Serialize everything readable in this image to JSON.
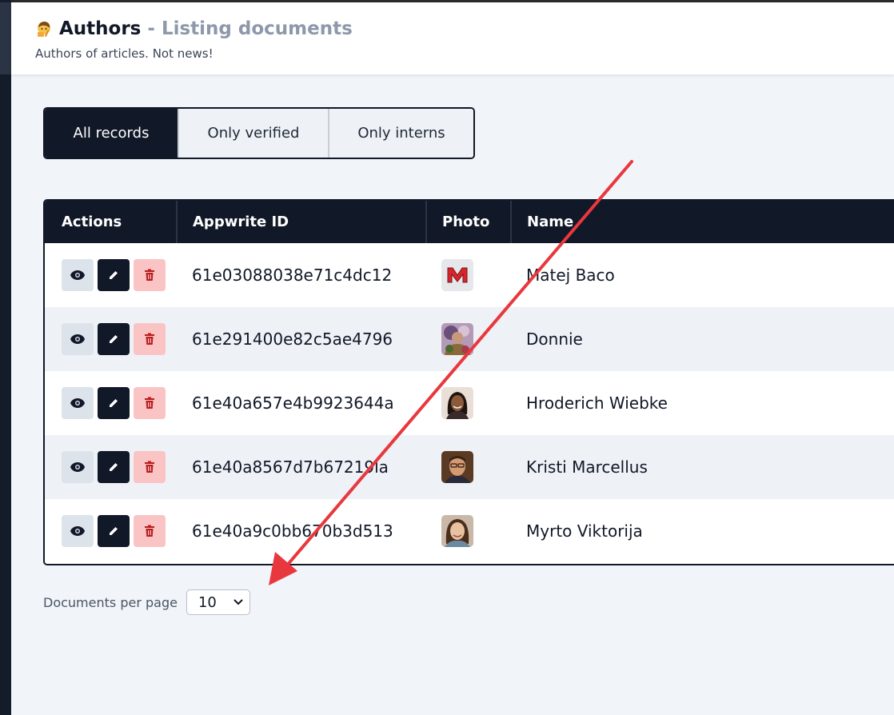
{
  "header": {
    "title": "Authors",
    "separator_title": "- Listing documents",
    "subtitle": "Authors of articles. Not news!",
    "icon": "author-emoji-icon"
  },
  "filters": [
    {
      "label": "All records",
      "active": true
    },
    {
      "label": "Only verified",
      "active": false
    },
    {
      "label": "Only interns",
      "active": false
    }
  ],
  "table": {
    "columns": [
      "Actions",
      "Appwrite ID",
      "Photo",
      "Name"
    ],
    "rows": [
      {
        "id": "61e03088038e71c4dc12",
        "name": "Matej Baco",
        "photo": "brand-logo-m"
      },
      {
        "id": "61e291400e82c5ae4796",
        "name": "Donnie",
        "photo": "avatar-photo"
      },
      {
        "id": "61e40a657e4b9923644a",
        "name": "Hroderich Wiebke",
        "photo": "avatar-photo"
      },
      {
        "id": "61e40a8567d7b67219la",
        "name": "Kristi Marcellus",
        "photo": "avatar-photo"
      },
      {
        "id": "61e40a9c0bb670b3d513",
        "name": "Myrto Viktorija",
        "photo": "avatar-photo"
      }
    ],
    "actions": [
      "eye-icon",
      "pencil-icon",
      "trash-icon"
    ]
  },
  "pagination": {
    "label": "Documents per page",
    "value": "10"
  },
  "colors": {
    "dark": "#111827",
    "accent_grey": "#8d99ab",
    "delete_bg": "#fbc4c4",
    "delete_icon": "#b91c1c",
    "annotation_arrow": "#e8383d"
  }
}
